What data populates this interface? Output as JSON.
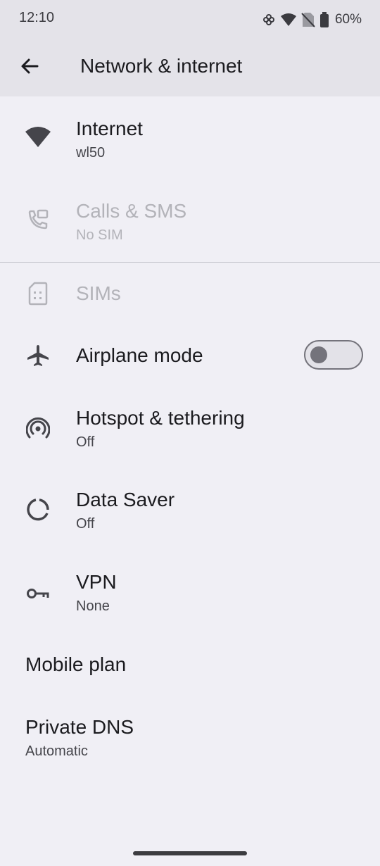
{
  "status_bar": {
    "time": "12:10",
    "battery_percent": "60%",
    "icons": [
      "vpn-key-cross-icon",
      "wifi-icon",
      "no-sim-icon",
      "battery-icon"
    ]
  },
  "app_bar": {
    "title": "Network & internet",
    "back_icon": "arrow-back-icon"
  },
  "items": {
    "internet": {
      "title": "Internet",
      "subtitle": "wl50",
      "icon": "wifi-icon"
    },
    "calls_sms": {
      "title": "Calls & SMS",
      "subtitle": "No SIM",
      "icon": "phone-sms-icon",
      "disabled": true
    },
    "sims": {
      "title": "SIMs",
      "icon": "sim-card-icon",
      "disabled": true
    },
    "airplane": {
      "title": "Airplane mode",
      "icon": "airplane-icon",
      "toggle_on": false
    },
    "hotspot": {
      "title": "Hotspot & tethering",
      "subtitle": "Off",
      "icon": "hotspot-icon"
    },
    "data_saver": {
      "title": "Data Saver",
      "subtitle": "Off",
      "icon": "data-saver-icon"
    },
    "vpn": {
      "title": "VPN",
      "subtitle": "None",
      "icon": "vpn-key-icon"
    },
    "mobile_plan": {
      "title": "Mobile plan"
    },
    "private_dns": {
      "title": "Private DNS",
      "subtitle": "Automatic"
    }
  },
  "colors": {
    "background": "#f0eff5",
    "header": "#e4e3e9",
    "text_primary": "#1b1b1f",
    "text_secondary": "#45454b",
    "text_disabled": "#b3b3b9",
    "toggle_outline": "#74737b"
  }
}
